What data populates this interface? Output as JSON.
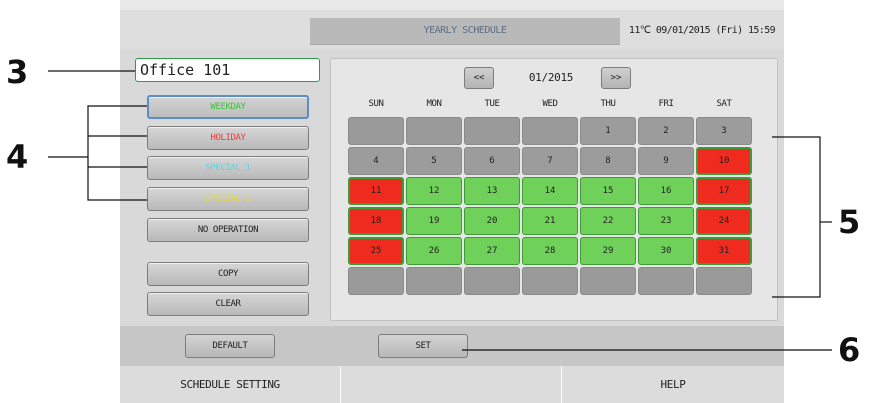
{
  "top_strip": {
    "text": "( ",
    "text_right": " )"
  },
  "header": {
    "title": "YEARLY SCHEDULE",
    "status": "11℃  09/01/2015 (Fri) 15:59"
  },
  "office": {
    "name": "Office 101"
  },
  "left_buttons": [
    {
      "label": "WEEKDAY",
      "color": "#3cc43c"
    },
    {
      "label": "HOLIDAY",
      "color": "#f03b3b"
    },
    {
      "label": "SPECIAL 1",
      "color": "#5fd3e0"
    },
    {
      "label": "SPECIAL 2",
      "color": "#e6d84a"
    },
    {
      "label": "NO OPERATION",
      "color": "#222222"
    },
    {
      "label": "COPY",
      "color": "#222222"
    },
    {
      "label": "CLEAR",
      "color": "#222222"
    }
  ],
  "calendar": {
    "prev_label": "<<",
    "next_label": ">>",
    "month": "01/2015",
    "weekdays": [
      "SUN",
      "MON",
      "TUE",
      "WED",
      "THU",
      "FRI",
      "SAT"
    ],
    "weeks": [
      [
        {
          "d": "",
          "t": "empty"
        },
        {
          "d": "",
          "t": "empty"
        },
        {
          "d": "",
          "t": "empty"
        },
        {
          "d": "",
          "t": "empty"
        },
        {
          "d": "1",
          "t": "gray"
        },
        {
          "d": "2",
          "t": "gray"
        },
        {
          "d": "3",
          "t": "gray"
        }
      ],
      [
        {
          "d": "4",
          "t": "gray"
        },
        {
          "d": "5",
          "t": "gray"
        },
        {
          "d": "6",
          "t": "gray"
        },
        {
          "d": "7",
          "t": "gray"
        },
        {
          "d": "8",
          "t": "gray"
        },
        {
          "d": "9",
          "t": "gray"
        },
        {
          "d": "10",
          "t": "red"
        }
      ],
      [
        {
          "d": "11",
          "t": "red"
        },
        {
          "d": "12",
          "t": "green"
        },
        {
          "d": "13",
          "t": "green"
        },
        {
          "d": "14",
          "t": "green"
        },
        {
          "d": "15",
          "t": "green"
        },
        {
          "d": "16",
          "t": "green"
        },
        {
          "d": "17",
          "t": "red"
        }
      ],
      [
        {
          "d": "18",
          "t": "red"
        },
        {
          "d": "19",
          "t": "green"
        },
        {
          "d": "20",
          "t": "green"
        },
        {
          "d": "21",
          "t": "green"
        },
        {
          "d": "22",
          "t": "green"
        },
        {
          "d": "23",
          "t": "green"
        },
        {
          "d": "24",
          "t": "red"
        }
      ],
      [
        {
          "d": "25",
          "t": "red"
        },
        {
          "d": "26",
          "t": "green"
        },
        {
          "d": "27",
          "t": "green"
        },
        {
          "d": "28",
          "t": "green"
        },
        {
          "d": "29",
          "t": "green"
        },
        {
          "d": "30",
          "t": "green"
        },
        {
          "d": "31",
          "t": "red"
        }
      ],
      [
        {
          "d": "",
          "t": "empty"
        },
        {
          "d": "",
          "t": "empty"
        },
        {
          "d": "",
          "t": "empty"
        },
        {
          "d": "",
          "t": "empty"
        },
        {
          "d": "",
          "t": "empty"
        },
        {
          "d": "",
          "t": "empty"
        },
        {
          "d": "",
          "t": "empty"
        }
      ]
    ]
  },
  "bottom_buttons": {
    "default_label": "DEFAULT",
    "set_label": "SET"
  },
  "footer": {
    "left": "SCHEDULE SETTING",
    "middle": "",
    "right": "HELP"
  },
  "callouts": [
    "3",
    "4",
    "5",
    "6"
  ],
  "colors": {
    "weekday": "#6fd15a",
    "holiday": "#ef2b1f",
    "unset": "#9c9c9c",
    "office_border": "#2f9a4b"
  }
}
